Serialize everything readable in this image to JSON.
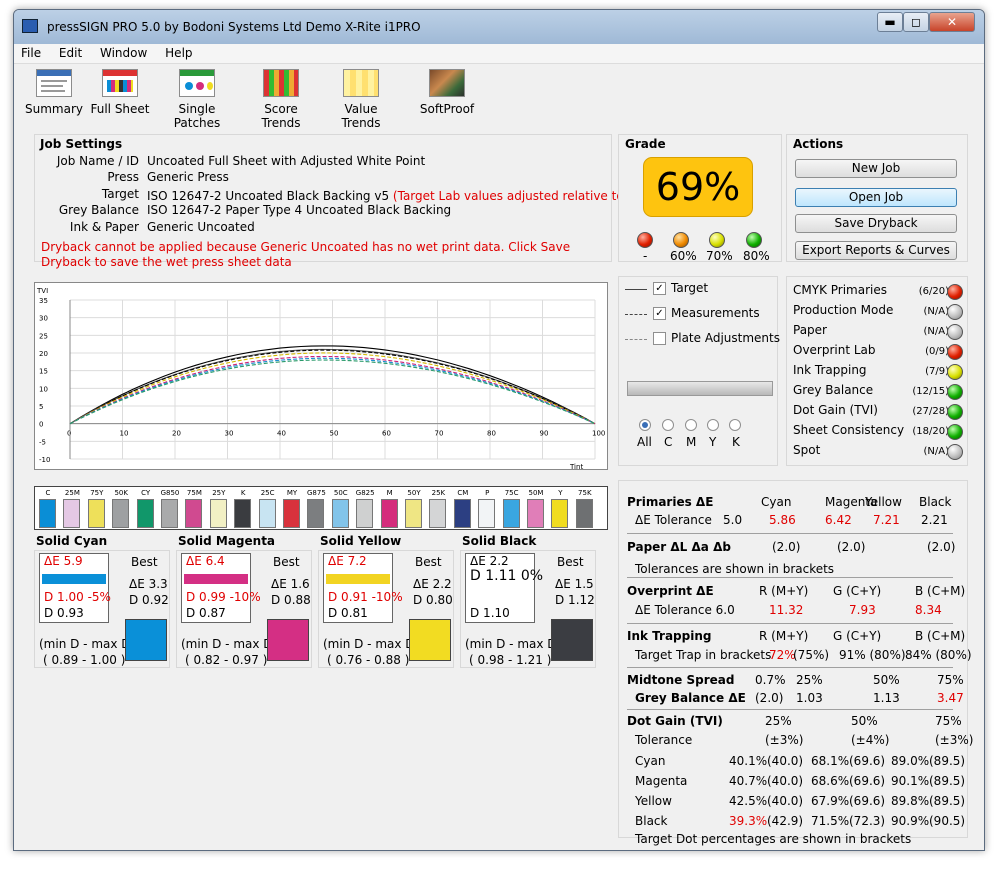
{
  "window": {
    "title": "pressSIGN PRO 5.0 by Bodoni Systems Ltd Demo X-Rite i1PRO",
    "minimize": "▬",
    "restore": "◻",
    "close": "✕"
  },
  "menu": [
    "File",
    "Edit",
    "Window",
    "Help"
  ],
  "toolbar": [
    "Summary",
    "Full Sheet",
    "Single Patches",
    "Score Trends",
    "Value Trends",
    "SoftProof"
  ],
  "job": {
    "heading": "Job Settings",
    "labels": {
      "name": "Job Name / ID",
      "press": "Press",
      "target": "Target",
      "grey": "Grey Balance",
      "ink": "Ink & Paper"
    },
    "values": {
      "name": "Uncoated Full Sheet with Adjusted White Point",
      "press": "Generic Press",
      "target": "ISO 12647-2 Uncoated Black Backing v5",
      "target_note": "(Target Lab values adjusted relative to paper)",
      "grey": "ISO 12647-2 Paper Type 4 Uncoated Black Backing",
      "ink": "Generic Uncoated"
    },
    "warning": "Dryback cannot be applied because Generic Uncoated has no wet print data. Click Save Dryback to save the wet press sheet data"
  },
  "grade": {
    "heading": "Grade",
    "value": "69%",
    "lights": [
      "-",
      "60%",
      "70%",
      "80%"
    ]
  },
  "actions": {
    "heading": "Actions",
    "buttons": [
      "New Job",
      "Open Job",
      "Save Dryback",
      "Export Reports & Curves"
    ]
  },
  "legend": {
    "items": [
      "Target",
      "Measurements",
      "Plate Adjustments"
    ],
    "radios": [
      "All",
      "C",
      "M",
      "Y",
      "K"
    ]
  },
  "status": [
    {
      "label": "CMYK Primaries",
      "value": "(6/20)",
      "light": "red"
    },
    {
      "label": "Production Mode",
      "value": "(N/A)",
      "light": "grey"
    },
    {
      "label": "Paper",
      "value": "(N/A)",
      "light": "grey"
    },
    {
      "label": "Overprint Lab",
      "value": "(0/9)",
      "light": "red"
    },
    {
      "label": "Ink Trapping",
      "value": "(7/9)",
      "light": "yellow"
    },
    {
      "label": "Grey Balance",
      "value": "(12/15)",
      "light": "green"
    },
    {
      "label": "Dot Gain (TVI)",
      "value": "(27/28)",
      "light": "green"
    },
    {
      "label": "Sheet Consistency",
      "value": "(18/20)",
      "light": "green"
    },
    {
      "label": "Spot",
      "value": "(N/A)",
      "light": "grey"
    }
  ],
  "chart_data": {
    "type": "line",
    "ylabel": "TVI",
    "xlabel": "Tint",
    "x_ticks": [
      0,
      10,
      20,
      30,
      40,
      50,
      60,
      70,
      80,
      90,
      100
    ],
    "y_ticks": [
      35,
      30,
      25,
      20,
      15,
      10,
      5,
      0,
      -5,
      -10
    ],
    "xlim": [
      0,
      100
    ],
    "ylim": [
      -10,
      35
    ],
    "series": [
      {
        "style": "solid",
        "color": "#000000",
        "peak": 22.0
      },
      {
        "style": "solid",
        "color": "#555555",
        "peak": 21.0
      },
      {
        "style": "dashed",
        "color": "#000000",
        "peak": 20.8
      },
      {
        "style": "dashed",
        "color": "#d4b800",
        "peak": 20.0
      },
      {
        "style": "dashed",
        "color": "#cc2277",
        "peak": 19.0
      },
      {
        "style": "dashed",
        "color": "#1a8fd0",
        "peak": 18.5
      },
      {
        "style": "dashed",
        "color": "#2a9a6a",
        "peak": 18.0
      }
    ]
  },
  "strip": [
    {
      "label": "C",
      "color": "#0a8ed6"
    },
    {
      "label": "25M",
      "color": "#e4c8e4"
    },
    {
      "label": "75Y",
      "color": "#eee05a"
    },
    {
      "label": "50K",
      "color": "#9ea0a2"
    },
    {
      "label": "CY",
      "color": "#11976a"
    },
    {
      "label": "G850",
      "color": "#a9aaab"
    },
    {
      "label": "75M",
      "color": "#d04a90"
    },
    {
      "label": "25Y",
      "color": "#f2f0c4"
    },
    {
      "label": "K",
      "color": "#3a3c40"
    },
    {
      "label": "25C",
      "color": "#c8e4f2"
    },
    {
      "label": "MY",
      "color": "#d8323c"
    },
    {
      "label": "G875",
      "color": "#7c7e80"
    },
    {
      "label": "50C",
      "color": "#82c4ea"
    },
    {
      "label": "G825",
      "color": "#cfd0d0"
    },
    {
      "label": "M",
      "color": "#d42d7c"
    },
    {
      "label": "50Y",
      "color": "#efe684"
    },
    {
      "label": "25K",
      "color": "#d4d5d6"
    },
    {
      "label": "CM",
      "color": "#2c3f82"
    },
    {
      "label": "P",
      "color": "#f2f4f6"
    },
    {
      "label": "75C",
      "color": "#3aa6e0"
    },
    {
      "label": "50M",
      "color": "#e07eb8"
    },
    {
      "label": "Y",
      "color": "#f0dc20"
    },
    {
      "label": "75K",
      "color": "#6e7072"
    }
  ],
  "solids": [
    {
      "title": "Solid Cyan",
      "de": "ΔE 5.9",
      "d": "D 1.00 -5%",
      "d2": "D 0.93",
      "best": "Best",
      "bde": "ΔE 3.3",
      "bd": "D 0.92",
      "range_label": "(min D - max D)",
      "range": "( 0.89 - 1.00 )",
      "color": "#0a90d8",
      "bar": "#0a90d8",
      "de_red": true,
      "d_red": true
    },
    {
      "title": "Solid Magenta",
      "de": "ΔE 6.4",
      "d": "D 0.99 -10%",
      "d2": "D 0.87",
      "best": "Best",
      "bde": "ΔE 1.6",
      "bd": "D 0.88",
      "range_label": "(min D - max D)",
      "range": "( 0.82 - 0.97 )",
      "color": "#d42f84",
      "bar": "#d42f84",
      "de_red": true,
      "d_red": true
    },
    {
      "title": "Solid Yellow",
      "de": "ΔE 7.2",
      "d": "D 0.91 -10%",
      "d2": "D 0.81",
      "best": "Best",
      "bde": "ΔE 2.2",
      "bd": "D 0.80",
      "range_label": "(min D - max D)",
      "range": "( 0.76 - 0.88 )",
      "color": "#f2dc22",
      "bar": "#f2d422",
      "de_red": true,
      "d_red": true
    },
    {
      "title": "Solid Black",
      "de": "ΔE 2.2",
      "d": "D 1.11 0%",
      "d2": "D 1.10",
      "best": "Best",
      "bde": "ΔE 1.5",
      "bd": "D 1.12",
      "range_label": "(min D - max D)",
      "range": "( 0.98 - 1.21 )",
      "color": "#3b3d42",
      "bar": "",
      "de_red": false,
      "d_red": false
    }
  ],
  "results": {
    "primaries": {
      "title": "Primaries ΔE",
      "cols": [
        "Cyan",
        "Magenta",
        "Yellow",
        "Black"
      ],
      "row_label": "ΔE Tolerance",
      "tol": "5.0",
      "vals": [
        "5.86",
        "6.42",
        "7.21",
        "2.21"
      ]
    },
    "paper": {
      "title": "Paper ΔL Δa Δb",
      "vals": [
        "(2.0)",
        "(2.0)",
        "(2.0)"
      ],
      "note": "Tolerances are shown in brackets"
    },
    "overprint": {
      "title": "Overprint ΔE",
      "cols": [
        "R (M+Y)",
        "G (C+Y)",
        "B (C+M)"
      ],
      "row_label": "ΔE Tolerance 6.0",
      "vals": [
        "11.32",
        "7.93",
        "8.34"
      ]
    },
    "trapping": {
      "title": "Ink Trapping",
      "cols": [
        "R (M+Y)",
        "G (C+Y)",
        "B (C+M)"
      ],
      "row_label": "Target Trap in brackets",
      "vals": [
        "72%",
        "(75%)",
        "91% (80%)",
        "84% (80%)"
      ]
    },
    "midtone": {
      "title": "Midtone Spread",
      "cols": [
        "0.7%",
        "25%",
        "50%",
        "75%"
      ],
      "row_label": "Grey Balance ΔE",
      "vals": [
        "(2.0)",
        "1.03",
        "1.13",
        "3.47"
      ]
    },
    "dotgain": {
      "title": "Dot Gain (TVI)",
      "cols": [
        "25%",
        "50%",
        "75%"
      ],
      "tol_label": "Tolerance",
      "tols": [
        "(±3%)",
        "(±4%)",
        "(±3%)"
      ],
      "rows": [
        {
          "label": "Cyan",
          "cells": [
            [
              "40.1%",
              "(40.0)"
            ],
            [
              "68.1%",
              "(69.6)"
            ],
            [
              "89.0%",
              "(89.5)"
            ]
          ]
        },
        {
          "label": "Magenta",
          "cells": [
            [
              "40.7%",
              "(40.0)"
            ],
            [
              "68.6%",
              "(69.6)"
            ],
            [
              "90.1%",
              "(89.5)"
            ]
          ]
        },
        {
          "label": "Yellow",
          "cells": [
            [
              "42.5%",
              "(40.0)"
            ],
            [
              "67.9%",
              "(69.6)"
            ],
            [
              "89.8%",
              "(89.5)"
            ]
          ]
        },
        {
          "label": "Black",
          "cells": [
            [
              "39.3%",
              "(42.9)"
            ],
            [
              "71.5%",
              "(72.3)"
            ],
            [
              "90.9%",
              "(90.5)"
            ]
          ]
        }
      ],
      "note": "Target Dot percentages are shown in brackets"
    }
  }
}
